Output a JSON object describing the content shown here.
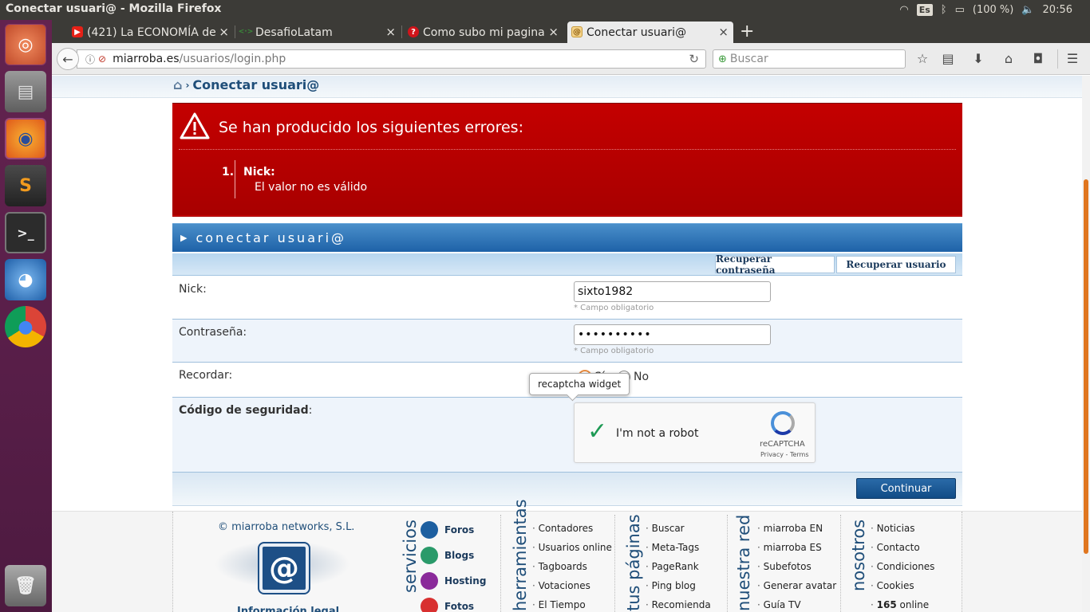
{
  "system": {
    "window_title": "Conectar usuari@ - Mozilla Firefox",
    "keyboard": "Es",
    "battery": "(100 %)",
    "time": "20:56"
  },
  "launcher": {
    "items": [
      "ubuntu-logo-icon",
      "files-icon",
      "firefox-icon",
      "sublime-text-icon",
      "terminal-icon",
      "fish-app-icon",
      "chrome-icon",
      "trash-icon"
    ]
  },
  "tabs": [
    {
      "label": "(421) La ECONOMÍA de",
      "favicon": "youtube-icon",
      "color": "#e62117"
    },
    {
      "label": "DesafioLatam",
      "favicon": "desafio-icon",
      "color": "#3a8a3a"
    },
    {
      "label": "Como subo mi pagina",
      "favicon": "question-icon",
      "color": "#d0141a"
    },
    {
      "label": "Conectar usuari@",
      "favicon": "miarroba-icon",
      "color": "#e0a020"
    }
  ],
  "navbar": {
    "url_domain": "miarroba.es",
    "url_path": "/usuarios/login.php",
    "search_placeholder": "Buscar"
  },
  "breadcrumb": {
    "label": "Conectar usuari@"
  },
  "errors": {
    "title": "Se han producido los siguientes errores:",
    "items": [
      {
        "num": "1.",
        "field": "Nick:",
        "message": "El valor no es válido"
      }
    ]
  },
  "form": {
    "header": "conectar usuari@",
    "recover_password": "Recuperar contraseña",
    "recover_user": "Recuperar usuario",
    "nick_label": "Nick:",
    "nick_value": "sixto1982",
    "required_note": "* Campo obligatorio",
    "password_label": "Contraseña:",
    "password_value": "••••••••••",
    "remember_label": "Recordar:",
    "remember_yes": "Sí",
    "remember_no": "No",
    "remember_selected": "Sí",
    "security_label": "Código de seguridad",
    "security_suffix": ":",
    "tooltip": "recaptcha widget",
    "captcha_label": "I'm not a robot",
    "captcha_brand": "reCAPTCHA",
    "captcha_links": "Privacy - Terms",
    "submit": "Continuar"
  },
  "footer": {
    "copyright": "© miarroba networks, S.L.",
    "legal": "Información legal",
    "col_servicios": "servicios",
    "services": [
      "Foros",
      "Blogs",
      "Hosting",
      "Fotos"
    ],
    "col_herramientas": "herramientas",
    "tools": [
      "Contadores",
      "Usuarios online",
      "Tagboards",
      "Votaciones",
      "El Tiempo"
    ],
    "col_paginas": "tus páginas",
    "pages": [
      "Buscar",
      "Meta-Tags",
      "PageRank",
      "Ping blog",
      "Recomienda"
    ],
    "col_red": "nuestra red",
    "network": [
      "miarroba EN",
      "miarroba ES",
      "Subefotos",
      "Generar avatar",
      "Guía TV"
    ],
    "col_nosotros": "nosotros",
    "about": [
      "Noticias",
      "Contacto",
      "Condiciones",
      "Cookies"
    ],
    "online_count": "165",
    "online_label": "online"
  },
  "colors": {
    "error_red": "#b80000",
    "header_blue": "#1e62a8",
    "accent_orange": "#e0761f"
  }
}
